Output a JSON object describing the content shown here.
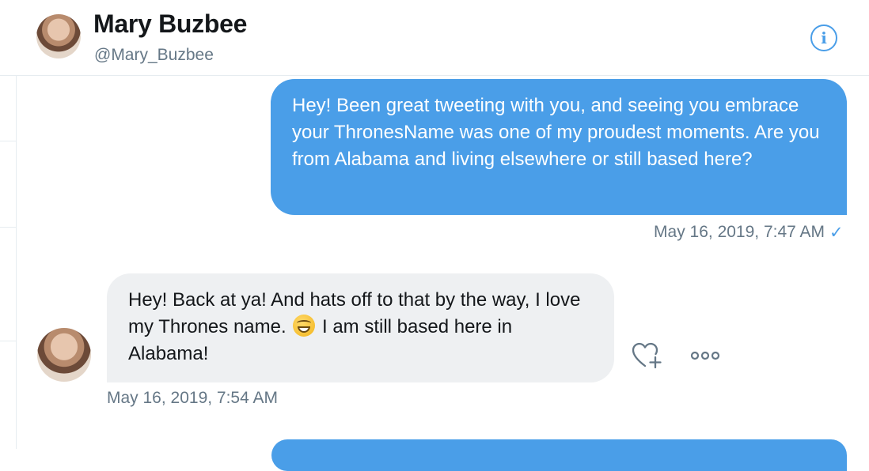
{
  "header": {
    "display_name": "Mary Buzbee",
    "handle": "@Mary_Buzbee",
    "info_icon": "info-icon"
  },
  "messages": [
    {
      "direction": "outgoing",
      "text": "Hey! Been great tweeting with you, and seeing you embrace your ThronesName was one of my proudest moments. Are you from Alabama and living elsewhere or still based here?",
      "timestamp": "May 16, 2019, 7:47 AM",
      "status_icon": "read-check-icon"
    },
    {
      "direction": "incoming",
      "text_part1": "Hey! Back at ya! And hats off to that by the way, I love my Thrones name.",
      "emoji": "grinning-face-emoji",
      "text_part2": "I am still based here in Alabama!",
      "timestamp": "May 16, 2019, 7:54 AM"
    },
    {
      "direction": "outgoing",
      "text": ""
    }
  ],
  "actions": {
    "react_icon": "heart-add-icon",
    "more_icon": "more-options-icon"
  },
  "colors": {
    "outgoing_bubble": "#4a9ee8",
    "incoming_bubble": "#eef0f2",
    "muted_text": "#657786",
    "accent": "#4a9ee8"
  }
}
